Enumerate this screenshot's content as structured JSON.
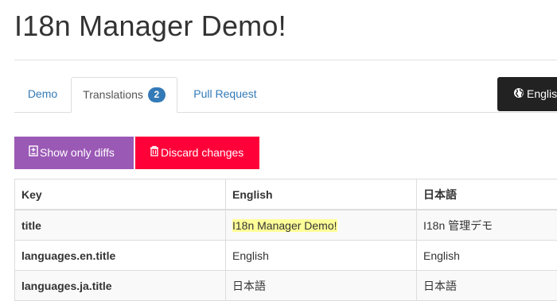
{
  "page": {
    "title": "I18n Manager Demo!"
  },
  "tabs": [
    {
      "label": "Demo",
      "active": false
    },
    {
      "label": "Translations",
      "badge": "2",
      "active": true
    },
    {
      "label": "Pull Request",
      "active": false
    }
  ],
  "language_button": {
    "label": "English",
    "icon": "globe-icon"
  },
  "toolbar": {
    "show_diffs_label": "Show only diffs",
    "show_diffs_icon": "diff-icon",
    "discard_label": "Discard changes",
    "discard_icon": "trash-icon"
  },
  "table": {
    "headers": [
      "Key",
      "English",
      "日本語"
    ],
    "rows": [
      {
        "key": "title",
        "en": "I18n Manager Demo!",
        "ja": "I18n 管理デモ",
        "en_changed": true
      },
      {
        "key": "languages.en.title",
        "en": "English",
        "ja": "English"
      },
      {
        "key": "languages.ja.title",
        "en": "日本語",
        "ja": "日本語"
      }
    ]
  },
  "colors": {
    "link": "#337ab7",
    "badge": "#337ab7",
    "show_diffs_button": "#9b59b6",
    "discard_button": "#ff0039",
    "language_button": "#222222",
    "changed_highlight": "#ffff99"
  }
}
